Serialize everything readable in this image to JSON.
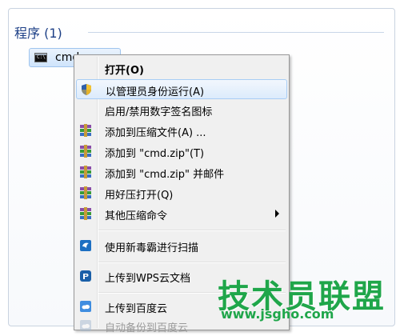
{
  "results": {
    "section_title": "程序 (1)",
    "item_label": "cmd"
  },
  "menu": {
    "items": [
      {
        "label": "打开(O)",
        "icon": "none",
        "bold": true
      },
      {
        "label": "以管理员身份运行(A)",
        "icon": "shield-icon",
        "hover": true
      },
      {
        "label": "启用/禁用数字签名图标",
        "icon": "none"
      },
      {
        "label": "添加到压缩文件(A) ...",
        "icon": "archive-icon"
      },
      {
        "label": "添加到 \"cmd.zip\"(T)",
        "icon": "archive-icon"
      },
      {
        "label": "添加到 \"cmd.zip\" 并邮件",
        "icon": "archive-icon"
      },
      {
        "label": "用好压打开(Q)",
        "icon": "archive-icon"
      },
      {
        "label": "其他压缩命令",
        "icon": "archive-icon",
        "submenu": true
      },
      {
        "label": "使用新毒霸进行扫描",
        "icon": "antivirus-icon"
      },
      {
        "label": "上传到WPS云文档",
        "icon": "wps-cloud-icon"
      },
      {
        "label": "上传到百度云",
        "icon": "baidu-cloud-icon"
      },
      {
        "label": "自动备份到百度云",
        "icon": "baidu-cloud-icon",
        "disabled": true
      }
    ]
  },
  "watermark": {
    "title": "技术员联盟",
    "url": "www.jsgho.com"
  },
  "colors": {
    "accent": "#1c3f86",
    "hover": "#dcebfc",
    "watermark": "#1fa64a"
  }
}
